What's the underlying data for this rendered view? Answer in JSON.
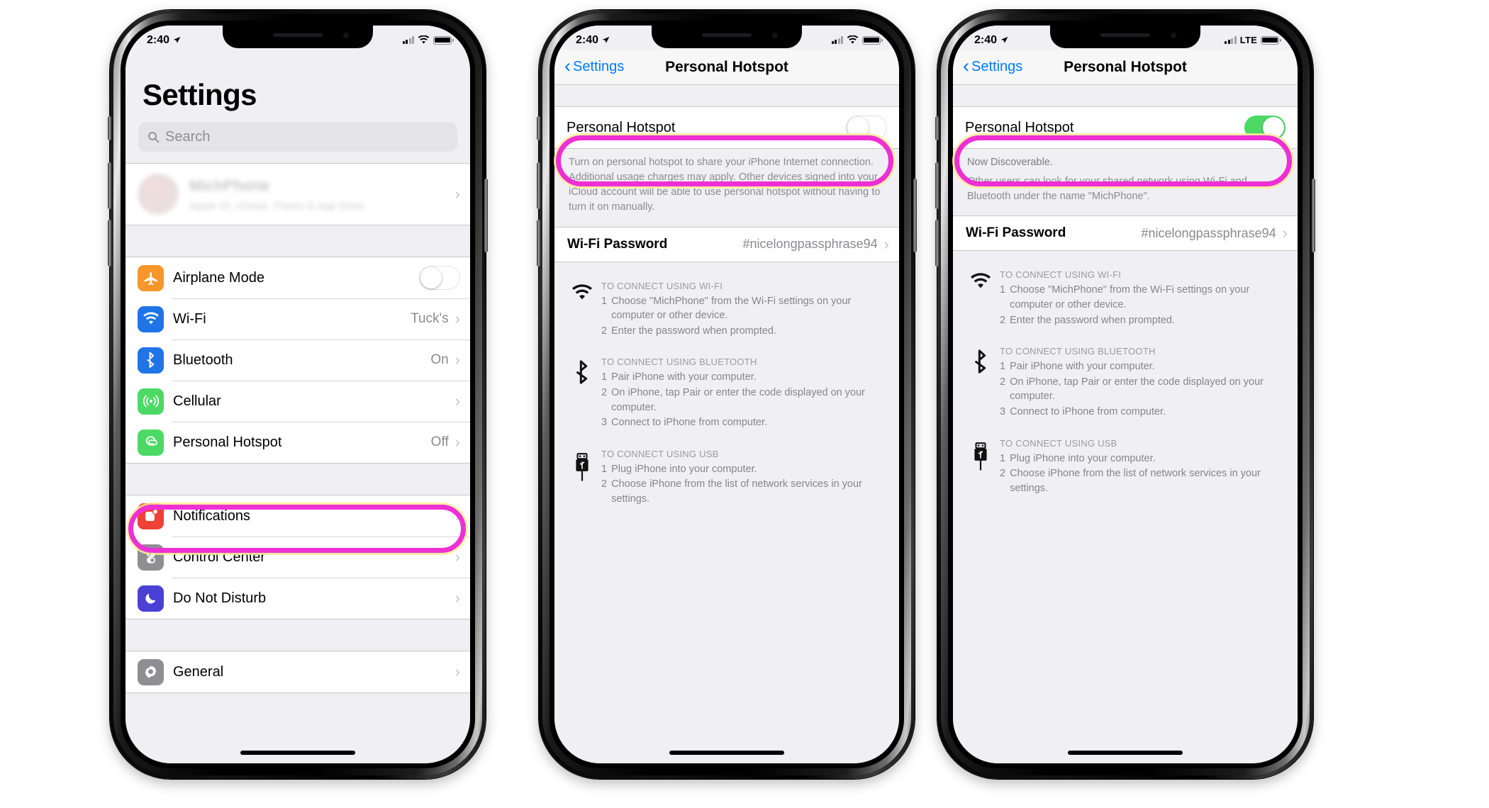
{
  "statusbar": {
    "time": "2:40",
    "lte_label": "LTE"
  },
  "phone1": {
    "title": "Settings",
    "search_placeholder": "Search",
    "apple_id": {
      "name": "MichPhone",
      "subtitle": "Apple ID, iCloud, iTunes & App Store"
    },
    "group1": [
      {
        "label": "Airplane Mode",
        "icon": "airplane-icon",
        "control": "toggle",
        "value": ""
      },
      {
        "label": "Wi-Fi",
        "icon": "wifi-icon",
        "control": "chevron",
        "value": "Tuck's"
      },
      {
        "label": "Bluetooth",
        "icon": "bluetooth-icon",
        "control": "chevron",
        "value": "On"
      },
      {
        "label": "Cellular",
        "icon": "cellular-icon",
        "control": "chevron",
        "value": ""
      },
      {
        "label": "Personal Hotspot",
        "icon": "hotspot-icon",
        "control": "chevron",
        "value": "Off"
      }
    ],
    "group2": [
      {
        "label": "Notifications",
        "icon": "notifications-icon",
        "control": "chevron",
        "value": ""
      },
      {
        "label": "Control Center",
        "icon": "control-center-icon",
        "control": "chevron",
        "value": ""
      },
      {
        "label": "Do Not Disturb",
        "icon": "moon-icon",
        "control": "chevron",
        "value": ""
      }
    ],
    "group3": [
      {
        "label": "General",
        "icon": "gear-icon",
        "control": "chevron",
        "value": ""
      }
    ]
  },
  "phone2": {
    "nav": {
      "back": "Settings",
      "title": "Personal Hotspot"
    },
    "toggle_label": "Personal Hotspot",
    "toggle_state": "off",
    "footnote": "Turn on personal hotspot to share your iPhone Internet connection. Additional usage charges may apply. Other devices signed into your iCloud account will be able to use personal hotspot without having to turn it on manually.",
    "wifi_password": {
      "label": "Wi-Fi Password",
      "value": "#nicelongpassphrase94"
    }
  },
  "phone3": {
    "nav": {
      "back": "Settings",
      "title": "Personal Hotspot"
    },
    "toggle_label": "Personal Hotspot",
    "toggle_state": "on",
    "footnote_lead": "Now Discoverable.",
    "footnote": "Other users can look for your shared network using Wi-Fi and Bluetooth under the name \"MichPhone\".",
    "wifi_password": {
      "label": "Wi-Fi Password",
      "value": "#nicelongpassphrase94"
    }
  },
  "instructions": [
    {
      "icon": "wifi-icon",
      "head": "TO CONNECT USING WI-FI",
      "steps": [
        {
          "n": "1",
          "text": "Choose \"MichPhone\" from the Wi-Fi settings on your computer or other device."
        },
        {
          "n": "2",
          "text": "Enter the password when prompted."
        }
      ]
    },
    {
      "icon": "bluetooth-icon",
      "head": "TO CONNECT USING BLUETOOTH",
      "steps": [
        {
          "n": "1",
          "text": "Pair iPhone with your computer."
        },
        {
          "n": "2",
          "text": "On iPhone, tap Pair or enter the code displayed on your computer."
        },
        {
          "n": "3",
          "text": "Connect to iPhone from computer."
        }
      ]
    },
    {
      "icon": "usb-icon",
      "head": "TO CONNECT USING USB",
      "steps": [
        {
          "n": "1",
          "text": "Plug iPhone into your computer."
        },
        {
          "n": "2",
          "text": "Choose iPhone from the list of network services in your settings."
        }
      ]
    }
  ],
  "colors": {
    "highlight": "#ee2fd4",
    "toggle_on": "#4cd964",
    "link": "#007aff",
    "airplane": "#f7962a",
    "wifi": "#1f74e8",
    "bluetooth": "#1f74e8",
    "cellular": "#4cd964",
    "hotspot": "#4cd964",
    "notifications": "#ef4136",
    "control_center": "#8e8e93",
    "dnd": "#4b40d6",
    "general": "#8e8e93"
  }
}
